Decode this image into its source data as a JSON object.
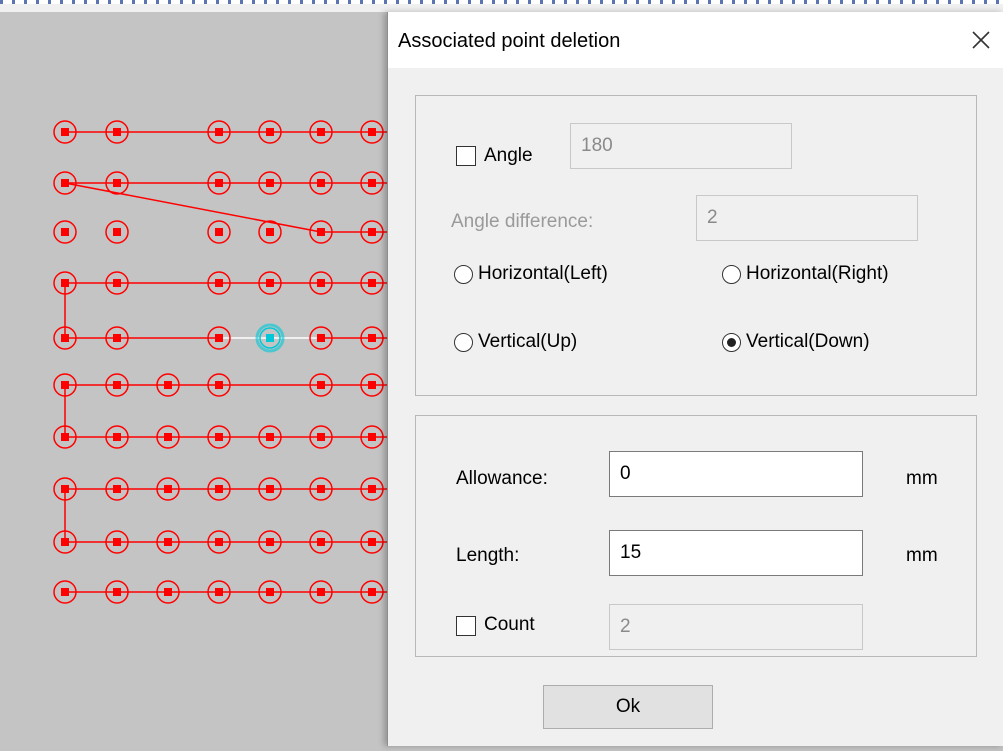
{
  "dialog": {
    "title": "Associated point deletion",
    "close_icon": "close-icon"
  },
  "direction_group": {
    "angle_checkbox": {
      "label": "Angle",
      "checked": false
    },
    "angle_value": "180",
    "angle_difference_label": "Angle difference:",
    "angle_difference_value": "2",
    "radios": [
      {
        "label": "Horizontal(Left)",
        "checked": false
      },
      {
        "label": "Horizontal(Right)",
        "checked": false
      },
      {
        "label": "Vertical(Up)",
        "checked": false
      },
      {
        "label": "Vertical(Down)",
        "checked": true
      }
    ]
  },
  "params_group": {
    "allowance_label": "Allowance:",
    "allowance_value": "0",
    "allowance_unit": "mm",
    "length_label": "Length:",
    "length_value": "15",
    "length_unit": "mm",
    "count_checkbox": {
      "label": "Count",
      "checked": false
    },
    "count_value": "2"
  },
  "ok_button": {
    "label": "Ok"
  },
  "canvas": {
    "point_color": "#ff0000",
    "selected_point_color": "#00c8d8",
    "grid_columns": 7,
    "grid_rows": 10,
    "missing_points": [
      [
        2,
        0
      ],
      [
        2,
        1
      ],
      [
        2,
        2
      ],
      [
        2,
        3
      ],
      [
        2,
        4
      ],
      [
        4,
        5
      ]
    ],
    "selected_point": [
      4,
      4
    ]
  },
  "ruler": {
    "accent": "#5a74b4"
  }
}
